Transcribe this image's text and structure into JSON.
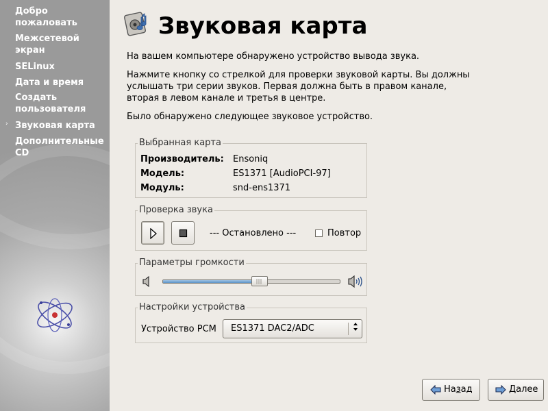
{
  "sidebar": {
    "items": [
      {
        "label": "Добро пожаловать",
        "active": false
      },
      {
        "label": "Межсетевой экран",
        "active": false
      },
      {
        "label": "SELinux",
        "active": false
      },
      {
        "label": "Дата и время",
        "active": false
      },
      {
        "label": "Создать пользователя",
        "active": false
      },
      {
        "label": "Звуковая карта",
        "active": true
      },
      {
        "label": "Дополнительные CD",
        "active": false
      }
    ],
    "active_marker": "›",
    "logo_icon": "fedora-atom-logo-icon"
  },
  "header": {
    "title": "Звуковая карта",
    "icon": "sound-card-icon"
  },
  "intro": {
    "detected": "На вашем компьютере обнаружено устройство вывода звука.",
    "instructions": "Нажмите кнопку со стрелкой для проверки звуковой карты.  Вы должны услышать три серии звуков.  Первая должна быть в правом канале, вторая в левом канале и третья в центре.",
    "found_device": "Было обнаружено следующее звуковое устройство."
  },
  "selected_card": {
    "frame_label": "Выбранная карта",
    "vendor_label": "Производитель:",
    "vendor_value": "Ensoniq",
    "model_label": "Модель:",
    "model_value": "ES1371 [AudioPCI-97]",
    "module_label": "Модуль:",
    "module_value": "snd-ens1371"
  },
  "sound_test": {
    "frame_label": "Проверка звука",
    "play_icon": "play-icon",
    "stop_icon": "stop-icon",
    "status": "--- Остановлено ---",
    "repeat_label": "Повтор",
    "repeat_checked": false
  },
  "volume": {
    "frame_label": "Параметры громкости",
    "level": 0.55,
    "min_icon": "speaker-low-icon",
    "max_icon": "speaker-high-icon"
  },
  "device_settings": {
    "frame_label": "Настройки устройства",
    "pcm_label": "Устройство PCM",
    "pcm_value": "ES1371 DAC2/ADC"
  },
  "footer": {
    "back_label": "Назад",
    "back_mnemonic_index": 2,
    "next_label": "Далее",
    "next_mnemonic_index": 0
  },
  "colors": {
    "background": "#eeebe6",
    "sidebar": "#a9a9a9",
    "slider_fill": "#6b9fd0"
  }
}
